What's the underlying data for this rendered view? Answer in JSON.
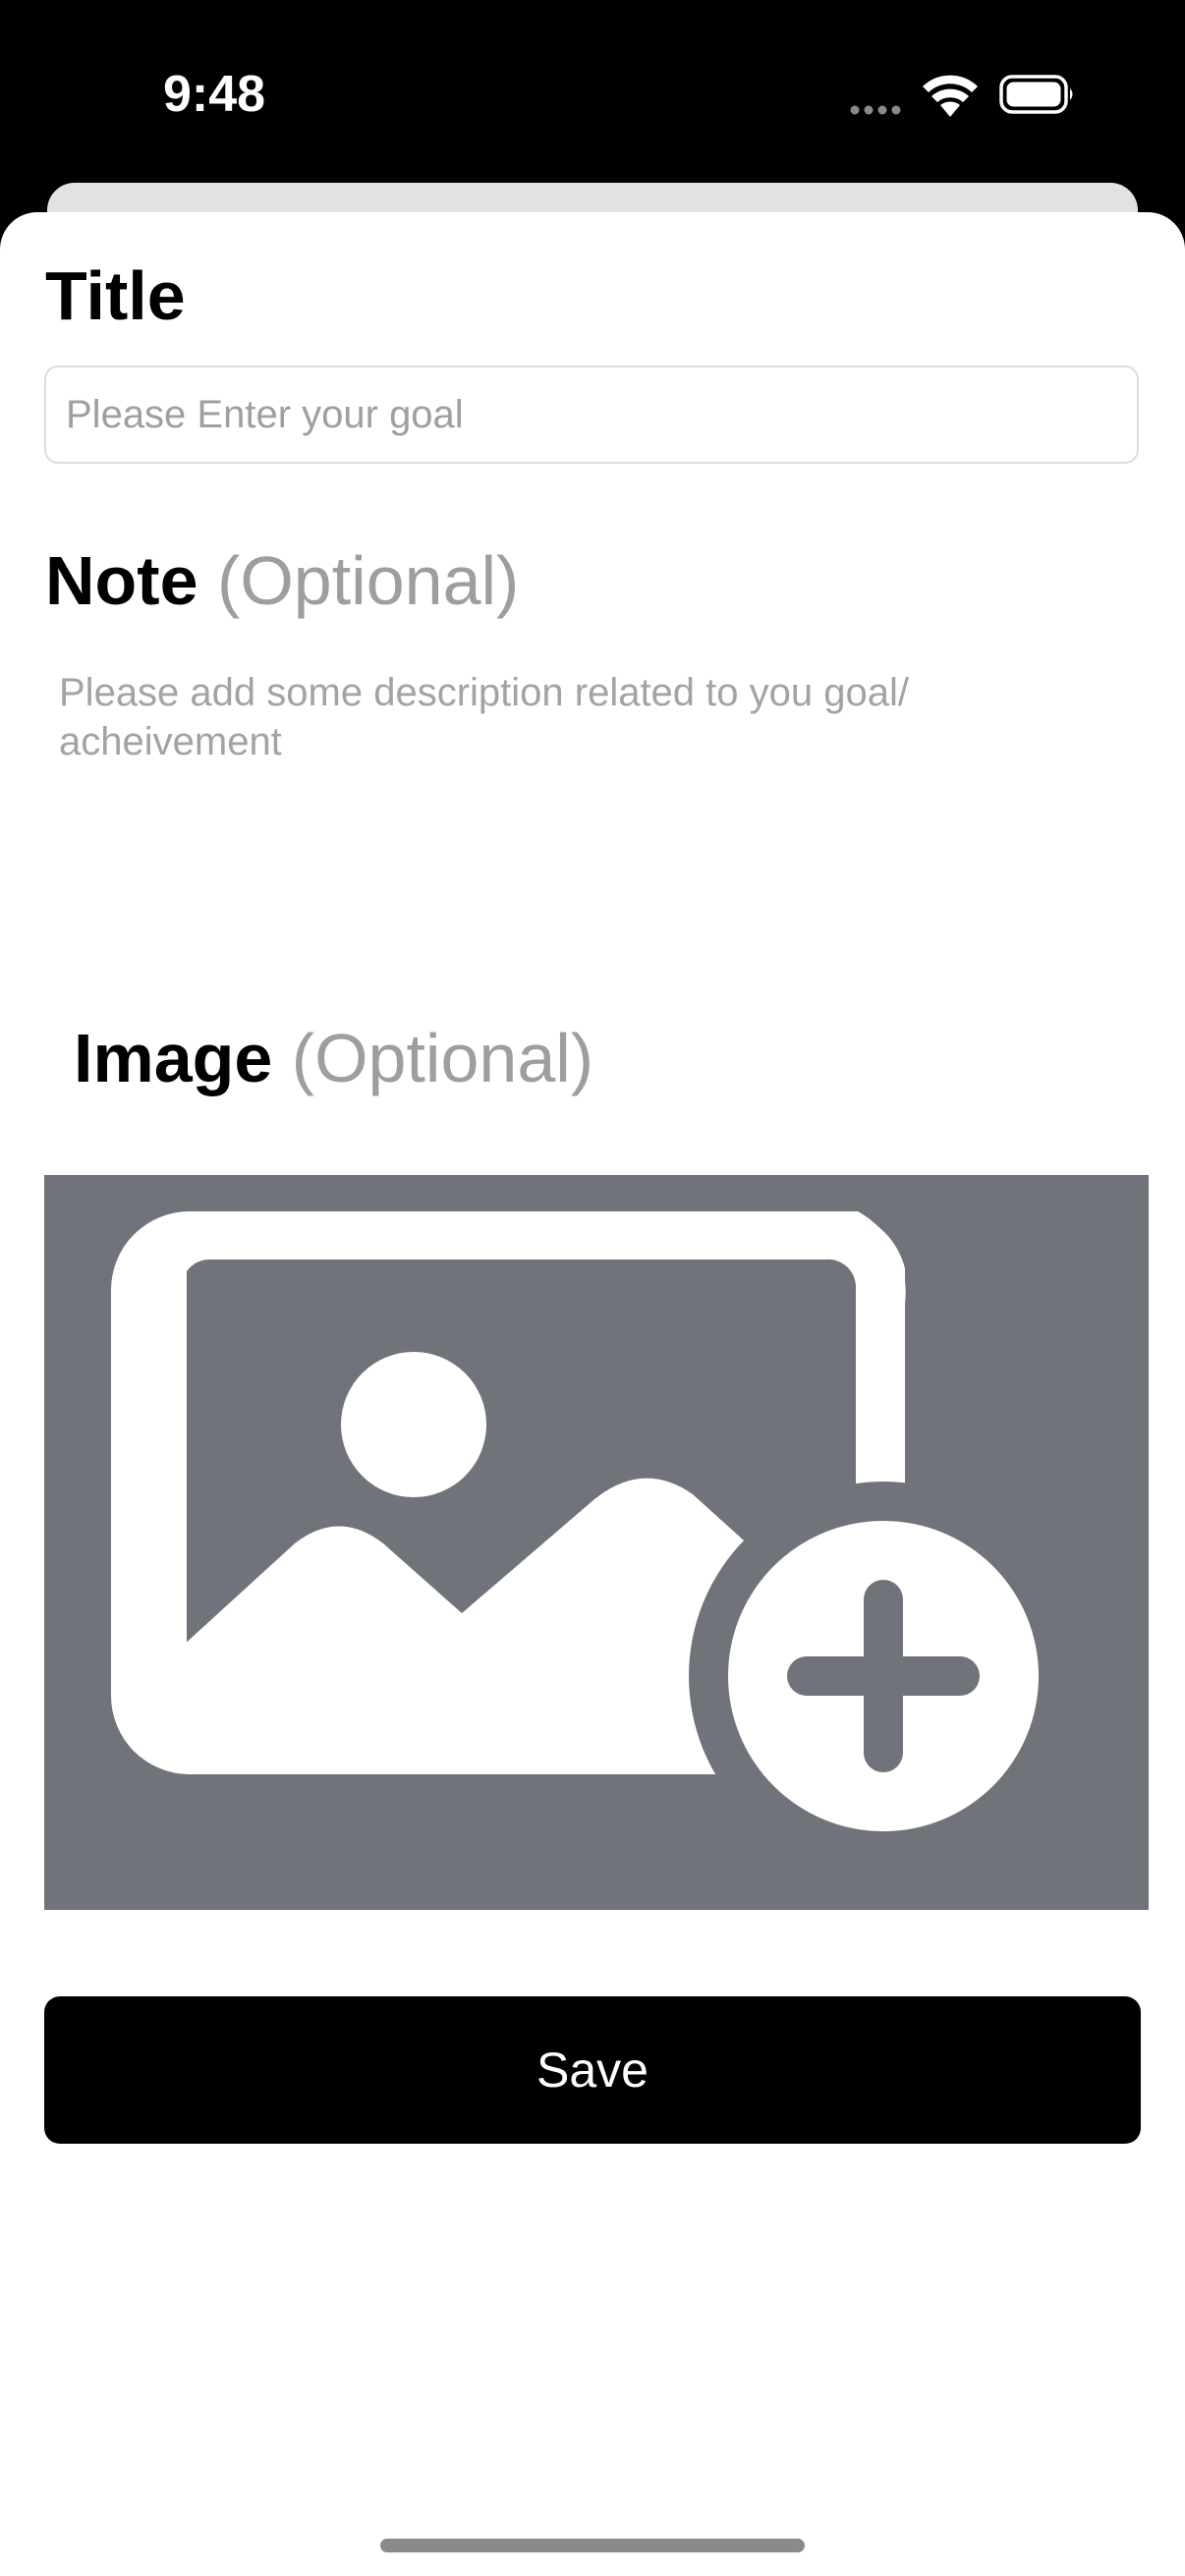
{
  "status_bar": {
    "time": "9:48",
    "icons": [
      "signal-dots-icon",
      "wifi-icon",
      "battery-icon"
    ]
  },
  "form": {
    "title": {
      "label": "Title",
      "placeholder": "Please Enter your goal",
      "value": ""
    },
    "note": {
      "label": "Note",
      "optional": "(Optional)",
      "placeholder": "Please add some description related to you goal/ acheivement",
      "value": ""
    },
    "image": {
      "label": "Image",
      "optional": "(Optional)",
      "icon": "add-photo-icon"
    },
    "save_label": "Save"
  },
  "colors": {
    "background": "#000000",
    "sheet": "#ffffff",
    "back_sheet": "#e2e2e2",
    "image_placeholder": "#70737a",
    "optional_text": "#9e9e9e",
    "button": "#000000",
    "button_text": "#ffffff"
  }
}
